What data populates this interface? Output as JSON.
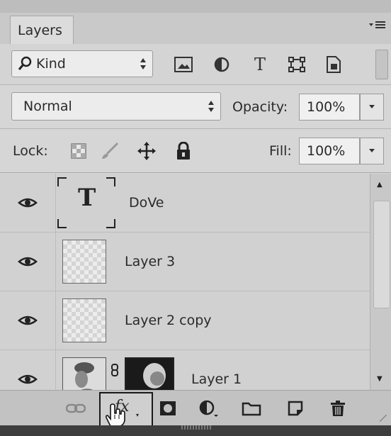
{
  "panel": {
    "tab_label": "Layers",
    "menu_icon": "panel-menu-icon"
  },
  "filter": {
    "kind_label": "Kind",
    "icons": [
      "pixel-layer-filter-icon",
      "adjustment-layer-filter-icon",
      "type-layer-filter-icon",
      "shape-layer-filter-icon",
      "smart-object-filter-icon"
    ]
  },
  "blend": {
    "mode": "Normal",
    "opacity_label": "Opacity:",
    "opacity_value": "100%"
  },
  "lock": {
    "label": "Lock:",
    "icons": [
      "lock-transparent-pixels-icon",
      "lock-image-pixels-icon",
      "lock-position-icon",
      "lock-all-icon"
    ],
    "fill_label": "Fill:",
    "fill_value": "100%"
  },
  "layers": [
    {
      "name": "DoVe",
      "type": "text",
      "thumb_glyph": "T"
    },
    {
      "name": "Layer 3",
      "type": "pixel"
    },
    {
      "name": "Layer 2 copy",
      "type": "pixel"
    },
    {
      "name": "Layer 1",
      "type": "pixel-with-mask"
    }
  ],
  "toolbar": {
    "fx_label": "fx",
    "icons": [
      "link-layers-icon",
      "add-layer-style-icon",
      "add-layer-mask-icon",
      "new-fill-adjustment-layer-icon",
      "new-group-icon",
      "new-layer-icon",
      "delete-layer-icon"
    ]
  },
  "colors": {
    "panel_bg": "#d8d8d8",
    "highlight_border": "#1a1a1a"
  }
}
